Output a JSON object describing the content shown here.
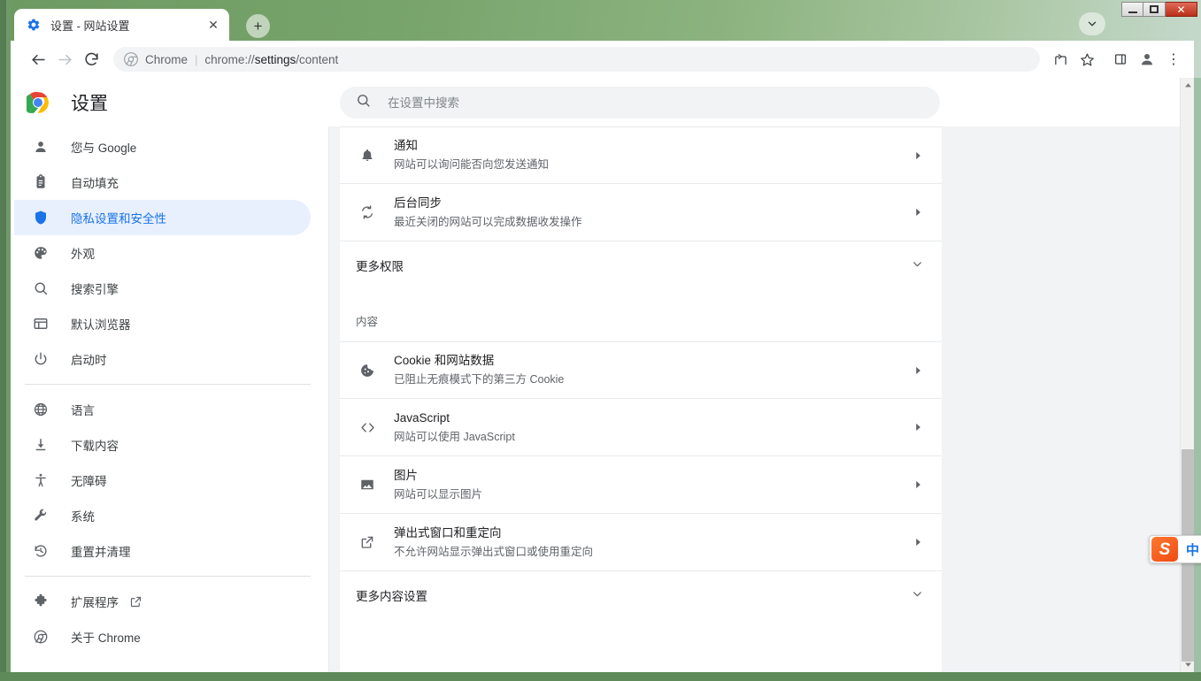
{
  "window": {
    "controls": [
      {
        "name": "minimize",
        "label": "—"
      },
      {
        "name": "maximize",
        "label": "❐"
      },
      {
        "name": "close",
        "label": "✕"
      }
    ],
    "theme_accent": "#6d9a62"
  },
  "tabstrip": {
    "tabs": [
      {
        "title": "设置 - 网站设置",
        "favicon": "gear-icon",
        "close_label": "✕"
      }
    ],
    "new_tab_label": "+",
    "tab_search_label": "⌄"
  },
  "toolbar": {
    "back_label": "←",
    "forward_label": "→",
    "reload_label": "⟳",
    "omnibox": {
      "scheme_label": "Chrome",
      "separator": "|",
      "url_prefix": "chrome://",
      "url_strong": "settings",
      "url_suffix": "/content"
    },
    "share_label": "share-icon",
    "bookmark_label": "star-icon",
    "sidepanel_label": "side-panel-icon",
    "profile_label": "profile-icon",
    "menu_label": "⋮"
  },
  "header": {
    "title": "设置",
    "logo": "chrome-logo"
  },
  "search": {
    "placeholder": "在设置中搜索",
    "value": "",
    "icon": "search-icon"
  },
  "sidebar": {
    "groups": [
      {
        "items": [
          {
            "icon": "person-icon",
            "label": "您与 Google",
            "active": false
          },
          {
            "icon": "clipboard-icon",
            "label": "自动填充",
            "active": false
          },
          {
            "icon": "shield-icon",
            "label": "隐私设置和安全性",
            "active": true
          },
          {
            "icon": "palette-icon",
            "label": "外观",
            "active": false
          },
          {
            "icon": "search-icon",
            "label": "搜索引擎",
            "active": false
          },
          {
            "icon": "browser-icon",
            "label": "默认浏览器",
            "active": false
          },
          {
            "icon": "power-icon",
            "label": "启动时",
            "active": false
          }
        ]
      },
      {
        "items": [
          {
            "icon": "globe-icon",
            "label": "语言",
            "active": false
          },
          {
            "icon": "download-icon",
            "label": "下载内容",
            "active": false
          },
          {
            "icon": "accessibility-icon",
            "label": "无障碍",
            "active": false
          },
          {
            "icon": "wrench-icon",
            "label": "系统",
            "active": false
          },
          {
            "icon": "restore-icon",
            "label": "重置并清理",
            "active": false
          }
        ]
      },
      {
        "items": [
          {
            "icon": "puzzle-icon",
            "label": "扩展程序",
            "active": false,
            "external": true
          },
          {
            "icon": "chrome-icon",
            "label": "关于 Chrome",
            "active": false
          }
        ]
      }
    ]
  },
  "main": {
    "permission_rows": [
      {
        "icon": "bell-icon",
        "title": "通知",
        "subtitle": "网站可以询问能否向您发送通知",
        "arrow": "▸"
      },
      {
        "icon": "sync-icon",
        "title": "后台同步",
        "subtitle": "最近关闭的网站可以完成数据收发操作",
        "arrow": "▸"
      }
    ],
    "more_permissions": {
      "label": "更多权限",
      "chevron": "⌄"
    },
    "content_section_label": "内容",
    "content_rows": [
      {
        "icon": "cookie-icon",
        "title": "Cookie 和网站数据",
        "subtitle": "已阻止无痕模式下的第三方 Cookie",
        "arrow": "▸"
      },
      {
        "icon": "code-icon",
        "title": "JavaScript",
        "subtitle": "网站可以使用 JavaScript",
        "arrow": "▸"
      },
      {
        "icon": "image-icon",
        "title": "图片",
        "subtitle": "网站可以显示图片",
        "arrow": "▸"
      },
      {
        "icon": "popup-icon",
        "title": "弹出式窗口和重定向",
        "subtitle": "不允许网站显示弹出式窗口或使用重定向",
        "arrow": "▸"
      }
    ],
    "more_content": {
      "label": "更多内容设置",
      "chevron": "⌄"
    }
  },
  "scrollbar": {
    "up_label": "▲",
    "down_label": "▼"
  },
  "ime": {
    "logo_label": "S",
    "mode_label": "中",
    "more_label": "◂"
  }
}
